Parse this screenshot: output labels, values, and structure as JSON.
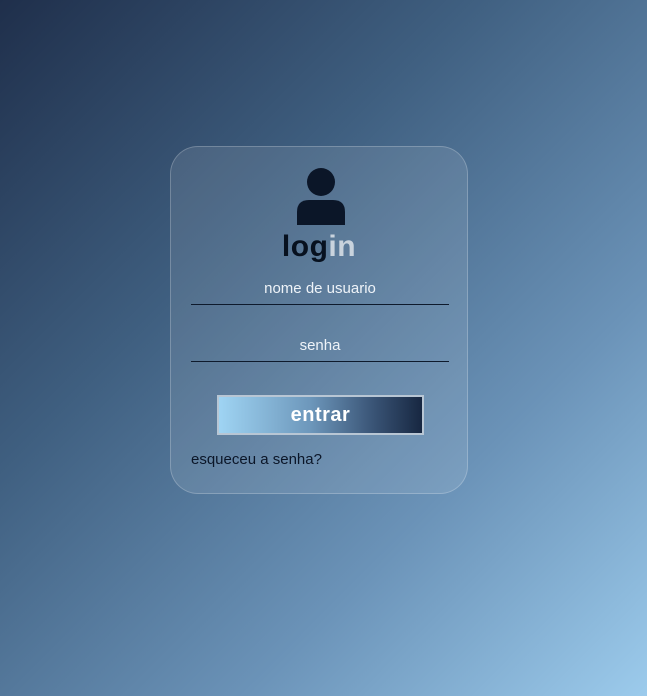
{
  "login": {
    "avatar_icon": "user-icon",
    "title_part1": "log",
    "title_part2": "in",
    "username_placeholder": "nome de usuario",
    "password_placeholder": "senha",
    "submit_label": "entrar",
    "forgot_label": "esqueceu a senha?"
  },
  "colors": {
    "title_dark": "#07111f",
    "title_light": "#c9d3dd",
    "field_underline": "#0e1a2c",
    "button_gradient_start": "#9fd4f3",
    "button_gradient_end": "#172741"
  }
}
